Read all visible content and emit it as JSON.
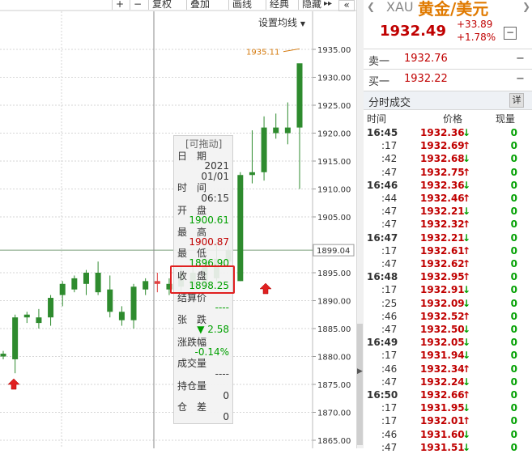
{
  "toolbar": {
    "plus": "+",
    "minus": "−",
    "fuquan": "复权",
    "diejia": "叠加",
    "huaxian": "画线",
    "jingdian": "经典",
    "yincang": "隐藏",
    "expand": "▸▸",
    "collapse": "«",
    "set_ma": "设置均线"
  },
  "chart_data": {
    "type": "candlestick",
    "ylim": [
      1865,
      1935
    ],
    "y_ticks": [
      "1935.00",
      "1930.00",
      "1925.00",
      "1920.00",
      "1915.00",
      "1910.00",
      "1905.00",
      "1899.04",
      "1895.00",
      "1890.00",
      "1885.00",
      "1880.00",
      "1875.00",
      "1870.00",
      "1865.00"
    ],
    "y_tick_values": [
      1935,
      1930,
      1925,
      1920,
      1915,
      1910,
      1905,
      1899.04,
      1895,
      1890,
      1885,
      1880,
      1875,
      1870,
      1865
    ],
    "current_price_line": 1899.04,
    "high_annotation": "1935.11",
    "up_color": "#2e8b2e",
    "down_color": "#2e8b2e",
    "special_color": "#e04040",
    "candles": [
      {
        "o": 1880.5,
        "h": 1881.0,
        "l": 1879.5,
        "c": 1880.0
      },
      {
        "o": 1879.5,
        "h": 1887.5,
        "l": 1877.0,
        "c": 1887.0
      },
      {
        "o": 1887.0,
        "h": 1888.0,
        "l": 1886.0,
        "c": 1887.5
      },
      {
        "o": 1887.0,
        "h": 1888.5,
        "l": 1885.0,
        "c": 1886.0
      },
      {
        "o": 1887.0,
        "h": 1891.0,
        "l": 1885.5,
        "c": 1890.5
      },
      {
        "o": 1891.0,
        "h": 1893.5,
        "l": 1889.0,
        "c": 1893.0
      },
      {
        "o": 1892.0,
        "h": 1894.5,
        "l": 1891.5,
        "c": 1894.0
      },
      {
        "o": 1893.0,
        "h": 1895.5,
        "l": 1891.0,
        "c": 1895.0
      },
      {
        "o": 1895.0,
        "h": 1897.0,
        "l": 1891.0,
        "c": 1891.5
      },
      {
        "o": 1892.0,
        "h": 1894.5,
        "l": 1887.0,
        "c": 1888.0
      },
      {
        "o": 1888.0,
        "h": 1889.0,
        "l": 1885.5,
        "c": 1886.5
      },
      {
        "o": 1886.5,
        "h": 1893.0,
        "l": 1885.0,
        "c": 1892.5
      },
      {
        "o": 1892.0,
        "h": 1894.0,
        "l": 1891.0,
        "c": 1893.5
      },
      {
        "o": 1893.0,
        "h": 1895.0,
        "l": 1891.5,
        "c": 1893.5,
        "special": true
      },
      {
        "o": 1893.0,
        "h": 1894.0,
        "l": 1891.0,
        "c": 1892.0
      },
      {
        "o": 1892.5,
        "h": 1896.0,
        "l": 1891.5,
        "c": 1895.0
      },
      {
        "o": 1895.0,
        "h": 1897.5,
        "l": 1892.0,
        "c": 1892.5
      },
      {
        "o": 1893.0,
        "h": 1898.0,
        "l": 1892.0,
        "c": 1897.5
      },
      {
        "o": 1897.5,
        "h": 1900.5,
        "l": 1893.5,
        "c": 1894.0
      },
      {
        "o": 1897.0,
        "h": 1900.0,
        "l": 1896.5,
        "c": 1899.0
      },
      {
        "o": 1893.5,
        "h": 1913.0,
        "l": 1893.5,
        "c": 1912.5
      },
      {
        "o": 1912.5,
        "h": 1920.5,
        "l": 1911.0,
        "c": 1913.0
      },
      {
        "o": 1913.0,
        "h": 1923.0,
        "l": 1911.5,
        "c": 1921.0
      },
      {
        "o": 1921.0,
        "h": 1923.5,
        "l": 1919.0,
        "c": 1920.0
      },
      {
        "o": 1920.0,
        "h": 1925.5,
        "l": 1918.0,
        "c": 1921.0
      },
      {
        "o": 1921.0,
        "h": 1925.5,
        "l": 1910.0,
        "c": 1932.5
      }
    ]
  },
  "tooltip": {
    "title": "[可拖动]",
    "date_label": "日　期",
    "date_val1": "2021",
    "date_val2": "01/01",
    "time_label": "时　间",
    "time_val": "06:15",
    "open_label": "开　盘",
    "open_val": "1900.61",
    "high_label": "最　高",
    "high_val": "1900.87",
    "low_label": "最　低",
    "low_val": "1896.90",
    "close_label": "收　盘",
    "close_val": "1898.25",
    "settle_label": "结算价",
    "settle_val": "----",
    "chg_label": "张　跌",
    "chg_val": "▼ 2.58",
    "chgpct_label": "涨跌幅",
    "chgpct_val": "-0.14%",
    "vol_label": "成交量",
    "vol_val": "----",
    "oi_label": "持仓量",
    "oi_val": "0",
    "diff_label": "仓　差",
    "diff_val": "0"
  },
  "quote": {
    "nav_left": "❮",
    "nav_right": "❯",
    "symbol": "XAU",
    "name": "黄金/美元",
    "price": "1932.49",
    "change": "+33.89",
    "change_pct": "+1.78%",
    "collapse_btn": "−",
    "sell_label": "卖一",
    "sell_price": "1932.76",
    "sell_vol": "−",
    "buy_label": "买一",
    "buy_price": "1932.22",
    "buy_vol": "−",
    "section_title": "分时成交",
    "detail_btn": "详",
    "col_time": "时间",
    "col_price": "价格",
    "col_vol": "现量"
  },
  "ticks": [
    {
      "t": "16:45",
      "p": "1932.36",
      "d": "dn",
      "v": "0",
      "full": true
    },
    {
      "t": ":17",
      "p": "1932.69",
      "d": "up",
      "v": "0"
    },
    {
      "t": ":42",
      "p": "1932.68",
      "d": "dn",
      "v": "0"
    },
    {
      "t": ":47",
      "p": "1932.75",
      "d": "up",
      "v": "0"
    },
    {
      "t": "16:46",
      "p": "1932.36",
      "d": "dn",
      "v": "0",
      "full": true
    },
    {
      "t": ":44",
      "p": "1932.46",
      "d": "up",
      "v": "0"
    },
    {
      "t": ":47",
      "p": "1932.21",
      "d": "dn",
      "v": "0"
    },
    {
      "t": ":47",
      "p": "1932.32",
      "d": "up",
      "v": "0"
    },
    {
      "t": "16:47",
      "p": "1932.21",
      "d": "dn",
      "v": "0",
      "full": true
    },
    {
      "t": ":17",
      "p": "1932.61",
      "d": "up",
      "v": "0"
    },
    {
      "t": ":47",
      "p": "1932.62",
      "d": "up",
      "v": "0"
    },
    {
      "t": "16:48",
      "p": "1932.95",
      "d": "up",
      "v": "0",
      "full": true
    },
    {
      "t": ":17",
      "p": "1932.91",
      "d": "dn",
      "v": "0"
    },
    {
      "t": ":25",
      "p": "1932.09",
      "d": "dn",
      "v": "0"
    },
    {
      "t": ":46",
      "p": "1932.52",
      "d": "up",
      "v": "0"
    },
    {
      "t": ":47",
      "p": "1932.50",
      "d": "dn",
      "v": "0"
    },
    {
      "t": "16:49",
      "p": "1932.05",
      "d": "dn",
      "v": "0",
      "full": true
    },
    {
      "t": ":17",
      "p": "1931.94",
      "d": "dn",
      "v": "0"
    },
    {
      "t": ":46",
      "p": "1932.34",
      "d": "up",
      "v": "0"
    },
    {
      "t": ":47",
      "p": "1932.24",
      "d": "dn",
      "v": "0"
    },
    {
      "t": "16:50",
      "p": "1932.66",
      "d": "up",
      "v": "0",
      "full": true
    },
    {
      "t": ":17",
      "p": "1931.95",
      "d": "dn",
      "v": "0"
    },
    {
      "t": ":17",
      "p": "1932.01",
      "d": "up",
      "v": "0"
    },
    {
      "t": ":46",
      "p": "1931.60",
      "d": "dn",
      "v": "0"
    },
    {
      "t": ":47",
      "p": "1931.51",
      "d": "dn",
      "v": "0"
    }
  ]
}
